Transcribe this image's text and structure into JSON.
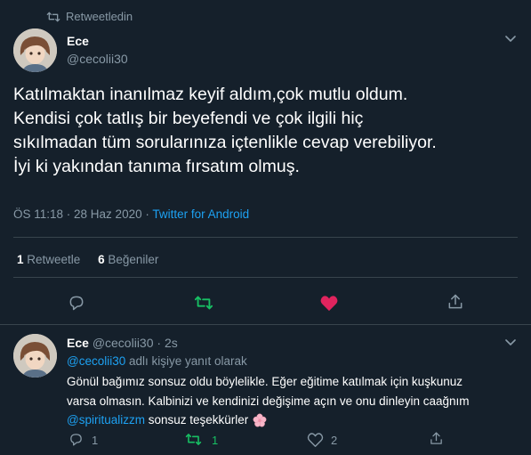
{
  "main_tweet": {
    "retweet_context": "Retweetledin",
    "author_name": "Ece",
    "author_handle": "@cecolii30",
    "text_lines": [
      "Katılmaktan inanılmaz keyif aldım,çok mutlu oldum.",
      "Kendisi çok tatlış bir beyefendi ve çok ilgili hiç",
      "sıkılmadan tüm sorularınıza içtenlikle cevap verebiliyor.",
      "İyi ki yakından tanıma fırsatım olmuş."
    ],
    "timestamp": "ÖS 11:18 · 28 Haz 2020 · ",
    "source": "Twitter for Android",
    "retweet_count": "1",
    "retweet_label": "Retweetle",
    "like_count": "6",
    "like_label": "Beğeniler"
  },
  "reply_tweet": {
    "author_name": "Ece",
    "author_handle": "@cecolii30",
    "time_sep": "·",
    "time_ago": "2s",
    "reply_to_user": "@cecolii30",
    "reply_to_suffix": " adlı kişiye yanıt olarak",
    "text_line1": "Gönül bağımız sonsuz oldu böylelikle. Eğer eğitime katılmak için kuşkunuz",
    "text_line2": "varsa olmasın. Kalbinizi ve kendinizi değişime açın ve onu dinleyin caağnım",
    "mention": "@spiritualizzm",
    "text_line3_suffix": " sonsuz teşekkürler",
    "reply_count": "1",
    "retweet_count": "1",
    "like_count": "2"
  },
  "colors": {
    "background": "#15202b",
    "divider": "#38444d",
    "muted_text": "#8899a6",
    "link": "#1da1f2",
    "retweet_active": "#17bf63",
    "like_active": "#e0245e"
  }
}
